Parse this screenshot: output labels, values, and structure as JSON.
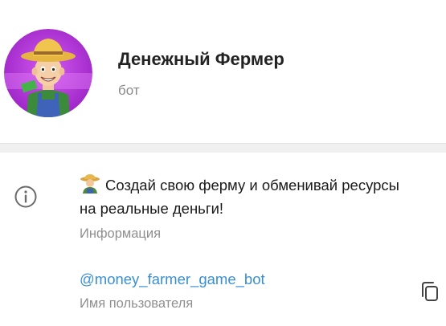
{
  "bot": {
    "name": "Денежный Фермер",
    "type": "бот",
    "avatar_icon": "farmer-avatar"
  },
  "info": {
    "icon": "info-circle-icon",
    "description": "Создай свою ферму и обменивай ресурсы на реальные деньги!",
    "description_label": "Информация"
  },
  "username": {
    "value": "@money_farmer_game_bot",
    "label": "Имя пользователя",
    "copy_icon": "copy-icon"
  },
  "colors": {
    "link": "#3a8fd1",
    "secondary_text": "#8f8f8f",
    "avatar_bg": "#b93ad6",
    "divider": "#f0f0f0"
  }
}
